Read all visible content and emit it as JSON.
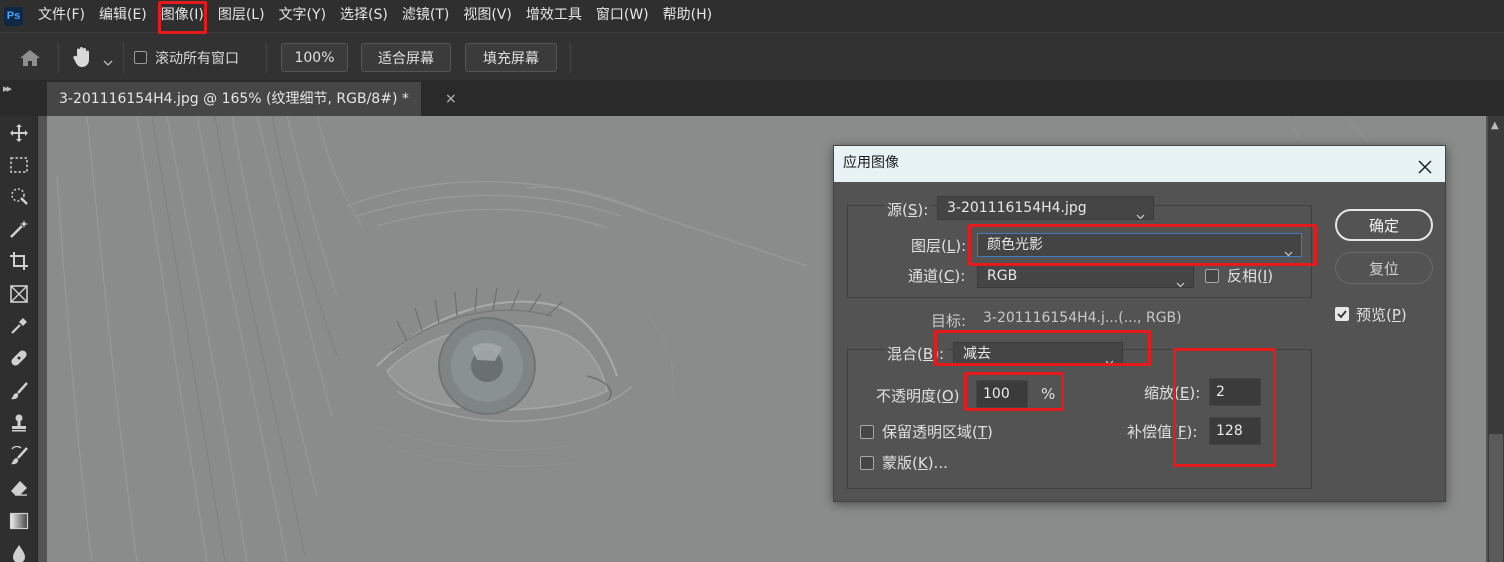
{
  "app": {
    "logo": "Ps"
  },
  "menu": [
    "文件(F)",
    "编辑(E)",
    "图像(I)",
    "图层(L)",
    "文字(Y)",
    "选择(S)",
    "滤镜(T)",
    "视图(V)",
    "增效工具",
    "窗口(W)",
    "帮助(H)"
  ],
  "options": {
    "scroll_all_label": "滚动所有窗口",
    "zoom_value": "100%",
    "fit_screen": "适合屏幕",
    "fill_screen": "填充屏幕"
  },
  "doc_tab": {
    "title": "3-201116154H4.jpg @ 165% (纹理细节, RGB/8#) *",
    "close": "×"
  },
  "tool_icons": [
    "move-icon",
    "marquee-icon",
    "quick-select-icon",
    "magic-wand-icon",
    "crop-icon",
    "frame-icon",
    "eyedropper-icon",
    "healing-brush-icon",
    "brush-icon",
    "clone-stamp-icon",
    "history-brush-icon",
    "eraser-icon",
    "gradient-icon",
    "blur-icon"
  ],
  "dialog": {
    "title": "应用图像",
    "source_label": "源(",
    "source_key": "S",
    "source_label_end": "):",
    "source_value": "3-201116154H4.jpg",
    "layer_label": "图层(",
    "layer_key": "L",
    "layer_label_end": "):",
    "layer_value": "颜色光影",
    "channel_label": "通道(",
    "channel_key": "C",
    "channel_label_end": "):",
    "channel_value": "RGB",
    "invert_label": "反相(",
    "invert_key": "I",
    "invert_label_end": ")",
    "target_label": "目标:",
    "target_value": "3-201116154H4.j...(..., RGB)",
    "blending_label": "混合(",
    "blending_key": "B",
    "blending_label_end": "):",
    "blending_value": "减去",
    "opacity_label": "不透明度(",
    "opacity_key": "O",
    "opacity_label_end": ")",
    "opacity_value": "100",
    "opacity_unit": "%",
    "scale_label": "缩放(",
    "scale_key": "E",
    "scale_label_end": "):",
    "scale_value": "2",
    "offset_label": "补偿值(",
    "offset_key": "F",
    "offset_label_end": "):",
    "offset_value": "128",
    "preserve_transparency_label": "保留透明区域(",
    "preserve_transparency_key": "T",
    "preserve_transparency_label_end": ")",
    "mask_label": "蒙版(",
    "mask_key": "K",
    "mask_label_end": ")...",
    "ok": "确定",
    "reset": "复位",
    "preview_label": "预览(",
    "preview_key": "P",
    "preview_label_end": ")",
    "preview_checked": true
  },
  "colors": {
    "annotation": "#e51b1b",
    "dialog_title_bg": "#e7f3f4",
    "canvas": "#8a8c8c"
  }
}
